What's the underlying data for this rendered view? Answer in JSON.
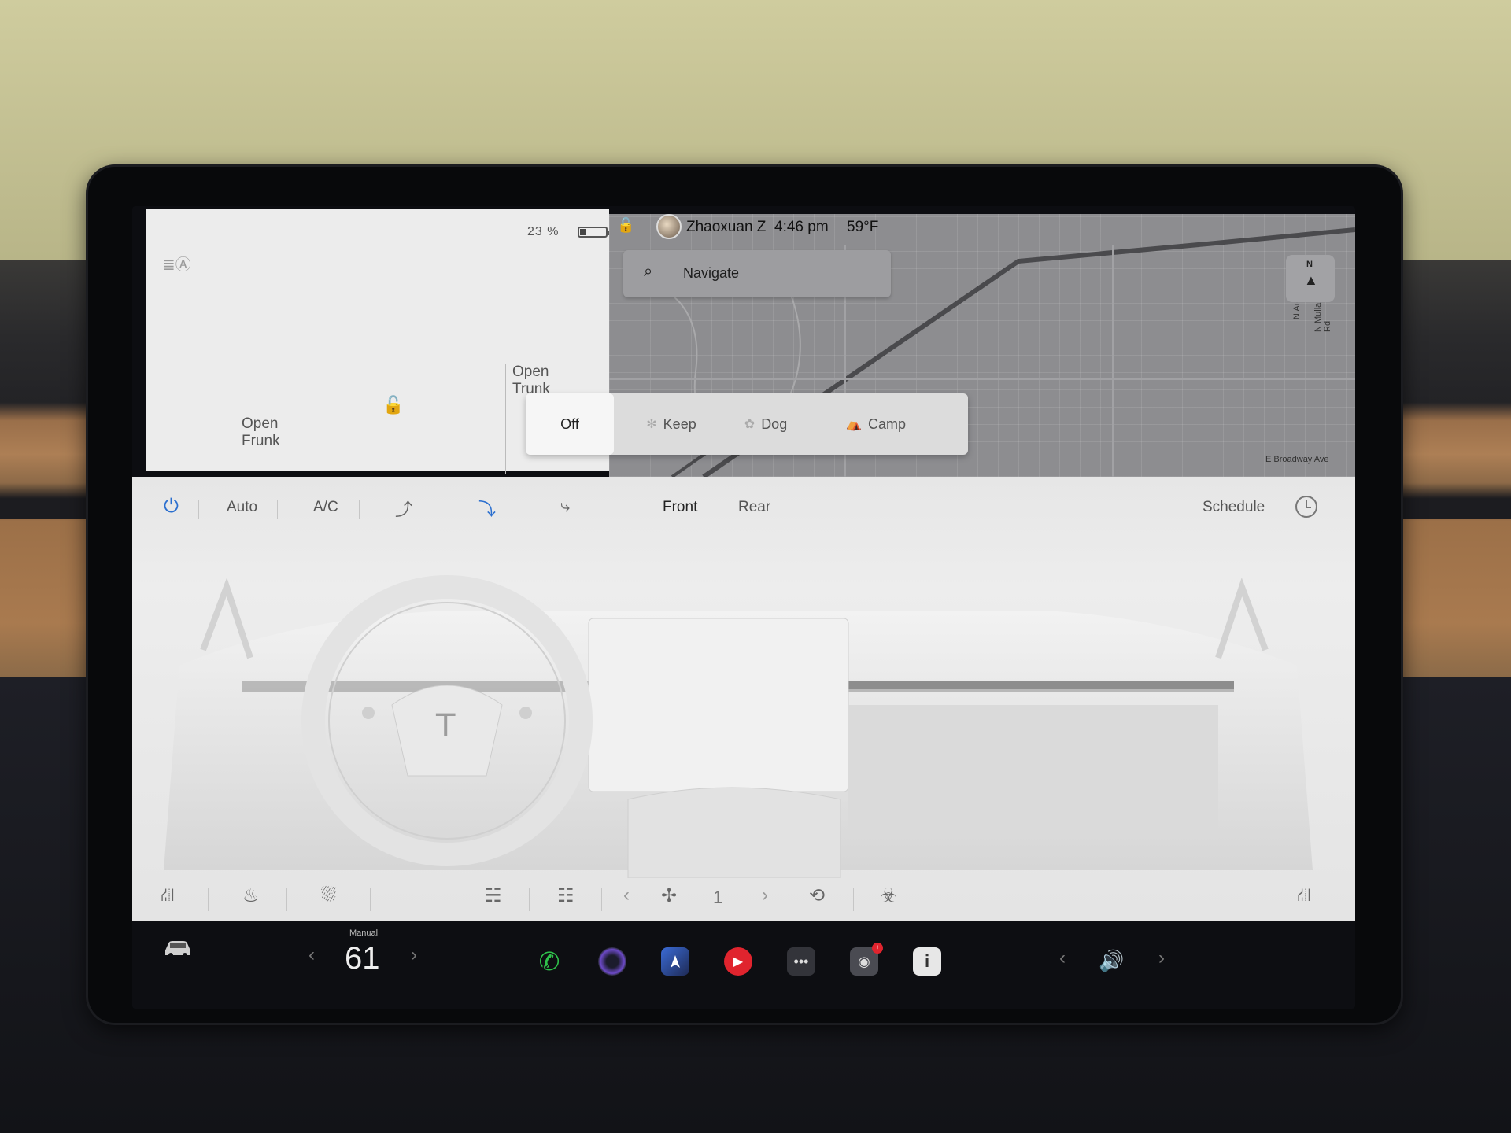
{
  "status": {
    "battery_percent": "23 %",
    "battery_level": 0.23,
    "open_frunk": "Open\nFrunk",
    "open_trunk": "Open\nTrunk"
  },
  "topbar": {
    "user": "Zhaoxuan Z",
    "time": "4:46 pm",
    "temperature": "59°F"
  },
  "map": {
    "search_placeholder": "Navigate",
    "compass_label": "N",
    "streets": [
      "N Argonne Rd",
      "N Mullan Rd",
      "E Broadway Ave"
    ]
  },
  "modes": {
    "items": [
      {
        "label": "Off",
        "icon": "off"
      },
      {
        "label": "Keep",
        "icon": "fan-icon"
      },
      {
        "label": "Dog",
        "icon": "paw-icon"
      },
      {
        "label": "Camp",
        "icon": "tent-icon"
      }
    ],
    "selected": "Off"
  },
  "climate": {
    "auto": "Auto",
    "ac": "A/C",
    "front": "Front",
    "rear": "Rear",
    "schedule": "Schedule",
    "fan_speed": "1"
  },
  "taskbar": {
    "speed_mode": "Manual",
    "speed_value": "61",
    "dashcam_badge": "!"
  },
  "colors": {
    "accent_blue": "#2b6fcf",
    "phone_green": "#2fc24b",
    "media_red": "#e0242e"
  }
}
